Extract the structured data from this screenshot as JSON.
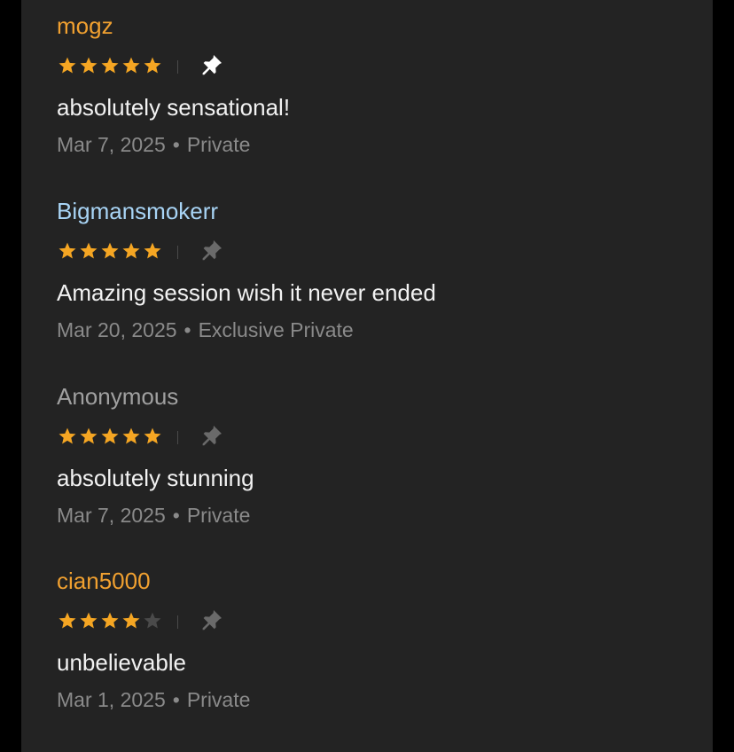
{
  "reviews": [
    {
      "name": "mogz",
      "name_color": "#f0a030",
      "rating": 5,
      "pinned": true,
      "text": "absolutely sensational!",
      "date": "Mar 7, 2025",
      "separator": "•",
      "session_type": "Private"
    },
    {
      "name": "Bigmansmokerr",
      "name_color": "#a8d4f5",
      "rating": 5,
      "pinned": false,
      "text": "Amazing session wish it never ended",
      "date": "Mar 20, 2025",
      "separator": "•",
      "session_type": "Exclusive Private"
    },
    {
      "name": "Anonymous",
      "name_color": "#a0a0a0",
      "rating": 5,
      "pinned": false,
      "text": "absolutely stunning",
      "date": "Mar 7, 2025",
      "separator": "•",
      "session_type": "Private"
    },
    {
      "name": "cian5000",
      "name_color": "#f0a030",
      "rating": 4,
      "pinned": false,
      "text": "unbelievable",
      "date": "Mar 1, 2025",
      "separator": "•",
      "session_type": "Private"
    }
  ],
  "colors": {
    "star_filled": "#f5a623",
    "star_empty": "#4a4a4a",
    "pin_active": "#ffffff",
    "pin_inactive": "#6a6a6a"
  },
  "icons": {
    "star": "star-icon",
    "pin": "pushpin-icon"
  }
}
